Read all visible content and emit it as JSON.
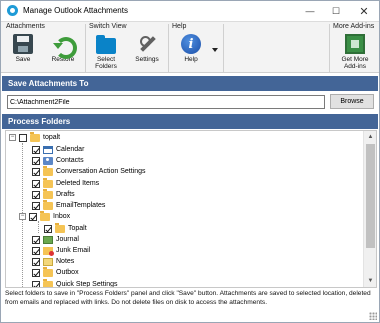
{
  "window": {
    "title": "Manage Outlook Attachments",
    "controls": {
      "minimize": "—",
      "maximize": "☐",
      "close": "✕"
    }
  },
  "ribbon": {
    "groups": {
      "attachments": "Attachments",
      "switch_view": "Switch View",
      "help": "Help",
      "more_addins": "More Add-ins"
    },
    "buttons": {
      "save": "Save",
      "restore": "Restore",
      "select_folders": "Select\nFolders",
      "settings": "Settings",
      "help": "Help",
      "help_glyph": "i",
      "get_more_addins": "Get More\nAdd-ins"
    }
  },
  "save_attachments": {
    "header": "Save Attachments To",
    "path": "C:\\Attachment2File",
    "browse": "Browse"
  },
  "process_folders": {
    "header": "Process Folders",
    "root": {
      "label": "topalt",
      "expander": "−",
      "checked": false
    },
    "items": [
      {
        "label": "Calendar",
        "icon": "calendar-icon",
        "checked": true
      },
      {
        "label": "Contacts",
        "icon": "contacts-icon",
        "checked": true
      },
      {
        "label": "Conversation Action Settings",
        "icon": "folder-icon",
        "checked": true
      },
      {
        "label": "Deleted Items",
        "icon": "folder-icon",
        "checked": true
      },
      {
        "label": "Drafts",
        "icon": "folder-icon",
        "checked": true
      },
      {
        "label": "EmailTemplates",
        "icon": "folder-icon",
        "checked": true
      },
      {
        "label": "Inbox",
        "icon": "folder-icon",
        "checked": true,
        "expander": "−"
      },
      {
        "label": "Topalt",
        "icon": "folder-icon",
        "checked": true,
        "child": true
      },
      {
        "label": "Journal",
        "icon": "journal-icon",
        "checked": true
      },
      {
        "label": "Junk Email",
        "icon": "junk-folder-icon",
        "checked": true
      },
      {
        "label": "Notes",
        "icon": "notes-icon",
        "checked": true
      },
      {
        "label": "Outbox",
        "icon": "folder-icon",
        "checked": true
      },
      {
        "label": "Quick Step Settings",
        "icon": "folder-icon",
        "checked": true
      }
    ]
  },
  "status": "Select folders to save in \"Process Folders\" panel and click \"Save\" button. Attachments are saved to selected location, deleted from emails and replaced with links. Do not delete files on disk to access the attachments.",
  "colors": {
    "panel_header": "#436597",
    "ribbon_bg": "#f3f3f3",
    "folder": "#f5c455"
  }
}
